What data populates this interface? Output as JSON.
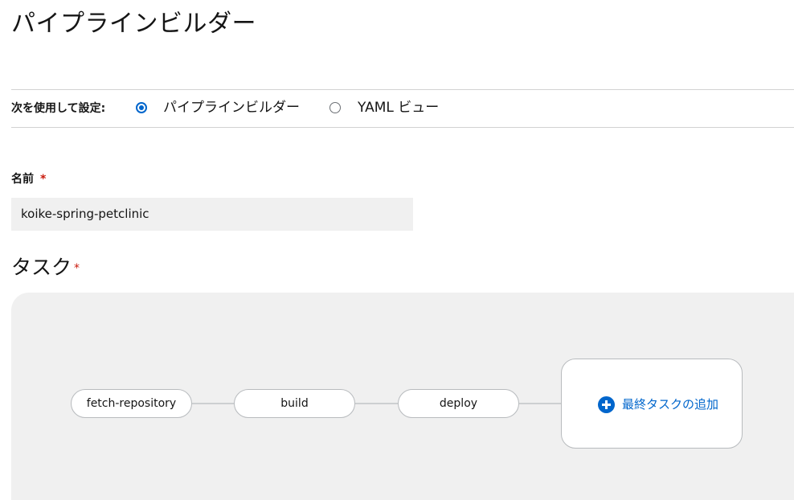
{
  "page": {
    "title": "パイプラインビルダー"
  },
  "config": {
    "label": "次を使用して設定:",
    "options": [
      {
        "label": "パイプラインビルダー",
        "selected": true
      },
      {
        "label": "YAML ビュー",
        "selected": false
      }
    ]
  },
  "name_field": {
    "label": "名前",
    "required_mark": "*",
    "value": "koike-spring-petclinic"
  },
  "tasks": {
    "title": "タスク",
    "required_mark": "*",
    "nodes": [
      {
        "label": "fetch-repository"
      },
      {
        "label": "build"
      },
      {
        "label": "deploy"
      }
    ],
    "add_final_task": {
      "label": "最終タスクの追加",
      "icon": "plus-circle-icon"
    }
  },
  "colors": {
    "accent": "#0066cc",
    "required": "#c9190b",
    "canvas_bg": "#f0f0f0"
  }
}
